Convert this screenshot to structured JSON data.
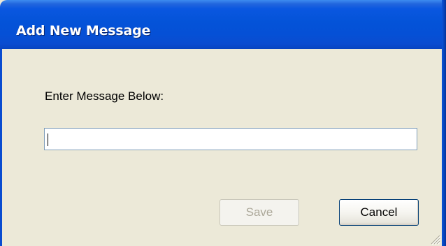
{
  "window": {
    "title": "Add New Message"
  },
  "form": {
    "prompt_label": "Enter Message Below:",
    "message_value": "",
    "message_placeholder": ""
  },
  "buttons": {
    "save_label": "Save",
    "save_enabled": false,
    "cancel_label": "Cancel"
  },
  "colors": {
    "titlebar": "#0453d8",
    "dialog_background": "#ece9d8",
    "input_border": "#7f9db9",
    "disabled_text": "#aca899",
    "default_button_border": "#003c74"
  },
  "icons": {
    "resize_grip": "resize-grip-icon"
  }
}
